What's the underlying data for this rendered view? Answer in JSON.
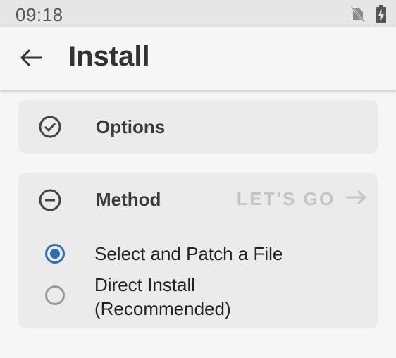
{
  "status_bar": {
    "time": "09:18",
    "icons": [
      "no-sim-icon",
      "battery-charging-icon"
    ]
  },
  "app_bar": {
    "back_icon": "arrow-left-icon",
    "title": "Install"
  },
  "options_card": {
    "icon": "check-circle-icon",
    "title": "Options"
  },
  "method_card": {
    "icon": "minus-circle-icon",
    "title": "Method",
    "action_label": "LET'S GO",
    "action_icon": "arrow-right-icon",
    "choices": [
      {
        "label": "Select and Patch a File",
        "selected": true
      },
      {
        "label_line1": "Direct Install",
        "label_line2": "(Recommended)",
        "selected": false
      }
    ]
  },
  "colors": {
    "accent": "#2e6db0",
    "card_background": "#ebebeb",
    "disabled_action": "#c4c4c4"
  }
}
